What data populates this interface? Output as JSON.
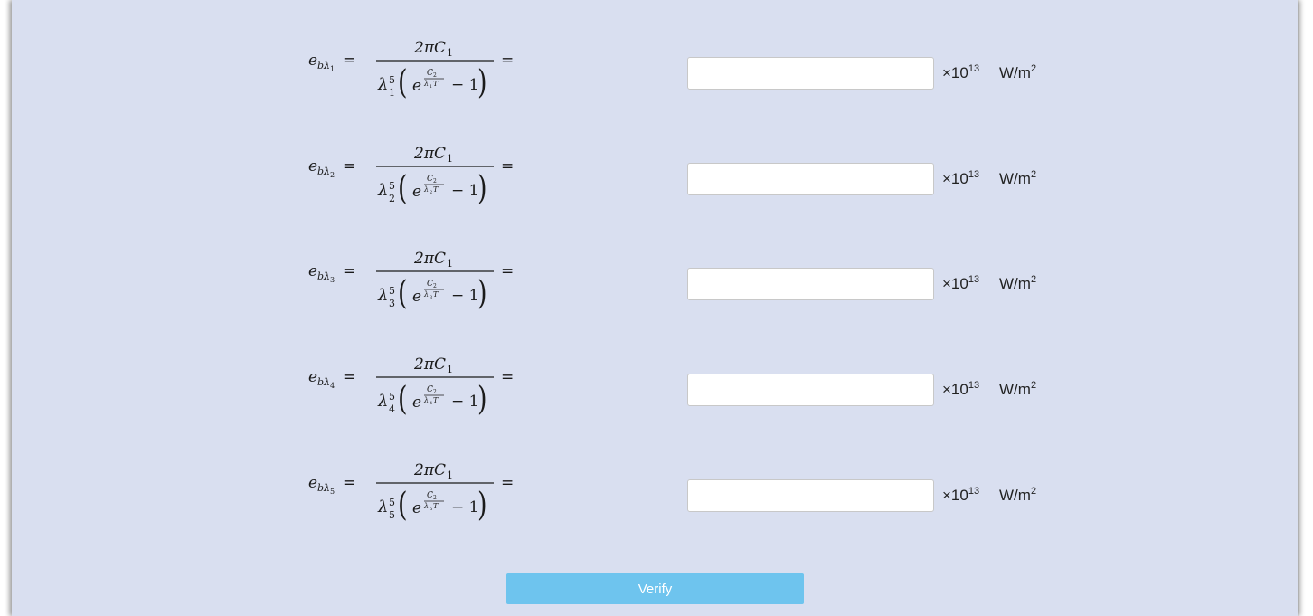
{
  "rows": [
    {
      "lhs_sub": "1",
      "answer_value": "",
      "multiplier_base": "×10",
      "multiplier_exp": "13",
      "unit_base": "W/m",
      "unit_exp": "2"
    },
    {
      "lhs_sub": "2",
      "answer_value": "",
      "multiplier_base": "×10",
      "multiplier_exp": "13",
      "unit_base": "W/m",
      "unit_exp": "2"
    },
    {
      "lhs_sub": "3",
      "answer_value": "",
      "multiplier_base": "×10",
      "multiplier_exp": "13",
      "unit_base": "W/m",
      "unit_exp": "2"
    },
    {
      "lhs_sub": "4",
      "answer_value": "",
      "multiplier_base": "×10",
      "multiplier_exp": "13",
      "unit_base": "W/m",
      "unit_exp": "2"
    },
    {
      "lhs_sub": "5",
      "answer_value": "",
      "multiplier_base": "×10",
      "multiplier_exp": "13",
      "unit_base": "W/m",
      "unit_exp": "2"
    }
  ],
  "formula": {
    "lhs_symbol": "e",
    "lhs_b": "b",
    "lambda": "λ",
    "equals": "=",
    "numerator": "2πC",
    "numerator_sub": "1",
    "denominator_power": "5",
    "exp_base": "e",
    "exp_num": "C",
    "exp_num_sub": "2",
    "exp_den_T": "T",
    "minus_one": "− 1"
  },
  "verify_label": "Verify"
}
